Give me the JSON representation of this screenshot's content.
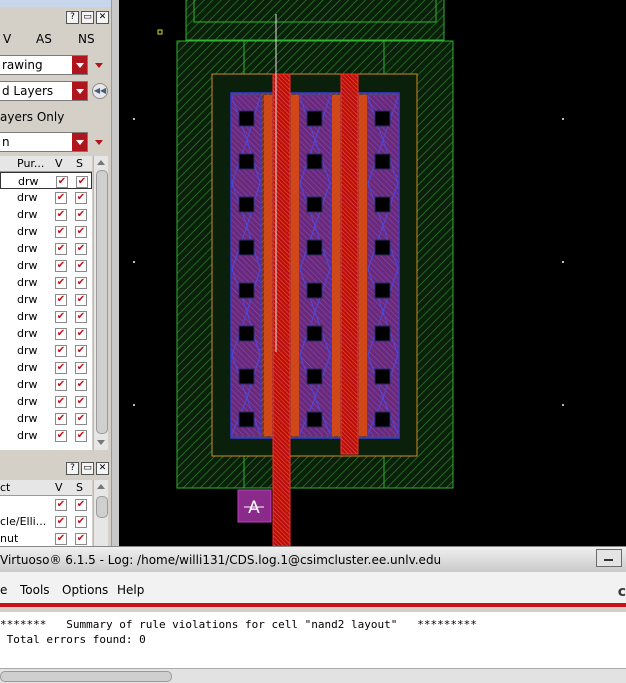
{
  "layers_panel": {
    "col_v": "V",
    "col_as": "AS",
    "col_ns": "NS",
    "purpose_select": "rawing",
    "layers_filter_select": "d Layers",
    "layers_only_label": "ayers Only",
    "search_select": "n",
    "header": {
      "purpose": "Pur...",
      "v": "V",
      "s": "S"
    },
    "rows_purpose": [
      "drw",
      "drw",
      "drw",
      "drw",
      "drw",
      "drw",
      "drw",
      "drw",
      "drw",
      "drw",
      "drw",
      "drw",
      "drw",
      "drw",
      "drw",
      "drw"
    ],
    "check_glyph": "✔"
  },
  "objects_panel": {
    "header": {
      "name": "ct",
      "v": "V",
      "s": "S"
    },
    "rows": [
      "",
      "cle/Elli...",
      "nut",
      ""
    ]
  },
  "canvas": {
    "pin_label": "A",
    "background": "#000000"
  },
  "log_window": {
    "title": "Virtuoso® 6.1.5 - Log: /home/willi131/CDS.log.1@csimcluster.ee.unlv.edu",
    "menus": [
      {
        "label": "e"
      },
      {
        "label": "Tools"
      },
      {
        "label": "Options"
      },
      {
        "label": "Help"
      }
    ],
    "brand": "c",
    "lines": [
      "*******   Summary of rule violations for cell \"nand2 layout\"   *********",
      " Total errors found: 0"
    ]
  },
  "colors": {
    "accent_red": "#c8101a",
    "nwell_green": "#20a020",
    "metal_blue": "#3030d0",
    "poly_red": "#d01010",
    "diff_brown": "#8a4a30"
  }
}
